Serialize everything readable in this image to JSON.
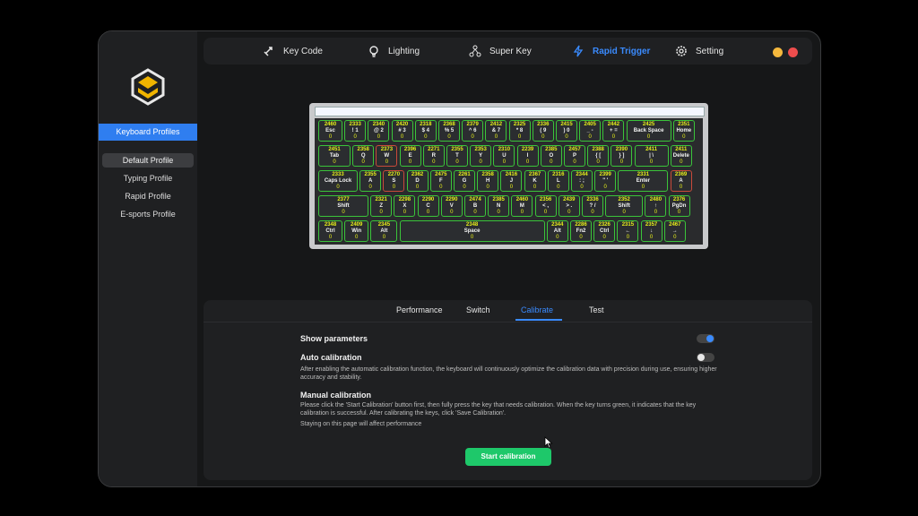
{
  "sidebar": {
    "header": "Keyboard Profiles",
    "items": [
      {
        "label": "Default Profile"
      },
      {
        "label": "Typing Profile"
      },
      {
        "label": "Rapid Profile"
      },
      {
        "label": "E-sports Profile"
      }
    ]
  },
  "nav": {
    "items": [
      {
        "label": "Key Code",
        "icon": "key-code-icon"
      },
      {
        "label": "Lighting",
        "icon": "bulb-icon"
      },
      {
        "label": "Super Key",
        "icon": "network-icon"
      },
      {
        "label": "Rapid Trigger",
        "icon": "lightning-icon"
      },
      {
        "label": "Setting",
        "icon": "gear-icon"
      }
    ],
    "active": "Rapid Trigger",
    "accent": "#3a8bff"
  },
  "window_controls": {
    "minimize_color": "#f5b83d",
    "close_color": "#ee4d4d"
  },
  "keyboard": {
    "rows": [
      [
        {
          "v": "2460",
          "l": "Esc",
          "s": "0"
        },
        {
          "v": "2333",
          "l": "! 1",
          "s": "0"
        },
        {
          "v": "2340",
          "l": "@ 2",
          "s": "0"
        },
        {
          "v": "2420",
          "l": "# 3",
          "s": "0"
        },
        {
          "v": "2318",
          "l": "$ 4",
          "s": "0"
        },
        {
          "v": "2368",
          "l": "% 5",
          "s": "0"
        },
        {
          "v": "2379",
          "l": "^ 6",
          "s": "0"
        },
        {
          "v": "2412",
          "l": "& 7",
          "s": "0"
        },
        {
          "v": "2325",
          "l": "* 8",
          "s": "0"
        },
        {
          "v": "2336",
          "l": "( 9",
          "s": "0"
        },
        {
          "v": "2415",
          "l": ") 0",
          "s": "0"
        },
        {
          "v": "2405",
          "l": "_ -",
          "s": "0"
        },
        {
          "v": "2442",
          "l": "+ =",
          "s": "0"
        },
        {
          "v": "2425",
          "l": "Back Space",
          "s": "0"
        },
        {
          "v": "2351",
          "l": "Home",
          "s": "0"
        }
      ],
      [
        {
          "v": "2451",
          "l": "Tab",
          "s": "0"
        },
        {
          "v": "2358",
          "l": "Q",
          "s": "0"
        },
        {
          "v": "2373",
          "l": "W",
          "s": "0"
        },
        {
          "v": "2396",
          "l": "E",
          "s": "0"
        },
        {
          "v": "2271",
          "l": "R",
          "s": "0"
        },
        {
          "v": "2355",
          "l": "T",
          "s": "0"
        },
        {
          "v": "2353",
          "l": "Y",
          "s": "0"
        },
        {
          "v": "2310",
          "l": "U",
          "s": "0"
        },
        {
          "v": "2239",
          "l": "I",
          "s": "0"
        },
        {
          "v": "2385",
          "l": "O",
          "s": "0"
        },
        {
          "v": "2457",
          "l": "P",
          "s": "0"
        },
        {
          "v": "2388",
          "l": "{ [",
          "s": "0"
        },
        {
          "v": "2390",
          "l": "} ]",
          "s": "0"
        },
        {
          "v": "2411",
          "l": "| \\",
          "s": "0"
        },
        {
          "v": "2411",
          "l": "Delete",
          "s": "0"
        }
      ],
      [
        {
          "v": "2333",
          "l": "Caps Lock",
          "s": "0"
        },
        {
          "v": "2355",
          "l": "A",
          "s": "0"
        },
        {
          "v": "2270",
          "l": "S",
          "s": "0"
        },
        {
          "v": "2362",
          "l": "D",
          "s": "0"
        },
        {
          "v": "2475",
          "l": "F",
          "s": "0"
        },
        {
          "v": "2261",
          "l": "G",
          "s": "0"
        },
        {
          "v": "2358",
          "l": "H",
          "s": "0"
        },
        {
          "v": "2416",
          "l": "J",
          "s": "0"
        },
        {
          "v": "2367",
          "l": "K",
          "s": "0"
        },
        {
          "v": "2316",
          "l": "L",
          "s": "0"
        },
        {
          "v": "2344",
          "l": ": ;",
          "s": "0"
        },
        {
          "v": "2399",
          "l": "\" '",
          "s": "0"
        },
        {
          "v": "2331",
          "l": "Enter",
          "s": "0"
        },
        {
          "v": "2369",
          "l": "A",
          "s": "0"
        }
      ],
      [
        {
          "v": "2377",
          "l": "Shift",
          "s": "0"
        },
        {
          "v": "2321",
          "l": "Z",
          "s": "0"
        },
        {
          "v": "2298",
          "l": "X",
          "s": "0"
        },
        {
          "v": "2290",
          "l": "C",
          "s": "0"
        },
        {
          "v": "2290",
          "l": "V",
          "s": "0"
        },
        {
          "v": "2474",
          "l": "B",
          "s": "0"
        },
        {
          "v": "2385",
          "l": "N",
          "s": "0"
        },
        {
          "v": "2460",
          "l": "M",
          "s": "0"
        },
        {
          "v": "2356",
          "l": "< ,",
          "s": "0"
        },
        {
          "v": "2439",
          "l": "> .",
          "s": "0"
        },
        {
          "v": "2336",
          "l": "? /",
          "s": "0"
        },
        {
          "v": "2352",
          "l": "Shift",
          "s": "0"
        },
        {
          "v": "2480",
          "l": "↑",
          "s": "0"
        },
        {
          "v": "2376",
          "l": "PgDn",
          "s": "0"
        }
      ],
      [
        {
          "v": "2348",
          "l": "Ctrl",
          "s": "0"
        },
        {
          "v": "2409",
          "l": "Win",
          "s": "0"
        },
        {
          "v": "2345",
          "l": "Alt",
          "s": "0"
        },
        {
          "v": "2348",
          "l": "Space",
          "s": "0"
        },
        {
          "v": "2344",
          "l": "Alt",
          "s": "0"
        },
        {
          "v": "2286",
          "l": "Fn2",
          "s": "0"
        },
        {
          "v": "2326",
          "l": "Ctrl",
          "s": "0"
        },
        {
          "v": "2315",
          "l": "←",
          "s": "0"
        },
        {
          "v": "2357",
          "l": "↓",
          "s": "0"
        },
        {
          "v": "2467",
          "l": "→",
          "s": "0"
        }
      ]
    ],
    "highlight_red": [
      "W",
      "S",
      "A"
    ]
  },
  "panel": {
    "tabs": [
      {
        "label": "Performance"
      },
      {
        "label": "Switch"
      },
      {
        "label": "Calibrate"
      },
      {
        "label": "Test"
      }
    ],
    "active_tab": "Calibrate",
    "show_parameters": {
      "label": "Show parameters",
      "on": true
    },
    "auto_calibration": {
      "label": "Auto calibration",
      "on": false,
      "description": "After enabling the automatic calibration function, the keyboard will continuously optimize the calibration data with precision during use, ensuring higher accuracy and stability."
    },
    "manual_calibration": {
      "label": "Manual calibration",
      "description": "Please click the 'Start Calibration' button first, then fully press the key that needs calibration. When the key turns green, it indicates that the key calibration is successful. After calibrating the keys, click 'Save Calibration'.",
      "note": "Staying on this page will affect performance"
    },
    "start_button": "Start calibration",
    "start_button_color": "#1ec86a"
  }
}
